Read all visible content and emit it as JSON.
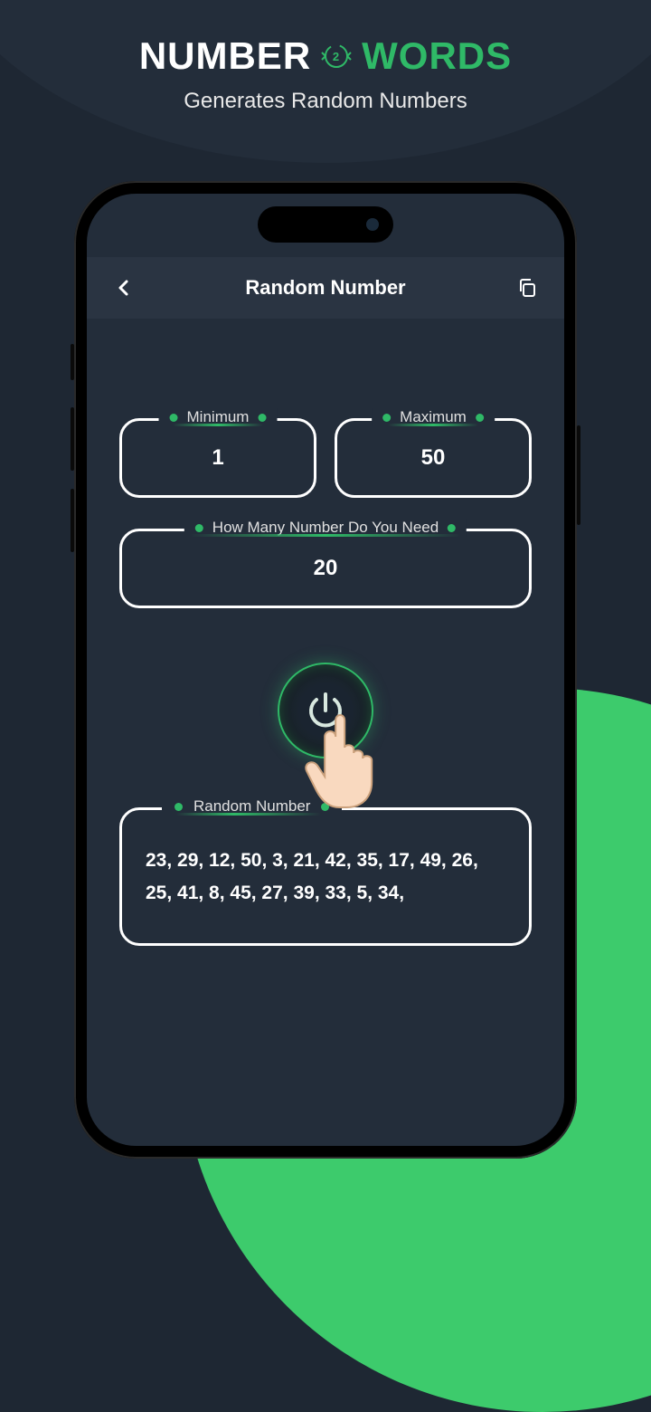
{
  "promo": {
    "title_part1": "NUMBER",
    "title_badge": "2",
    "title_part2": "WORDS",
    "subtitle": "Generates Random Numbers"
  },
  "appbar": {
    "title": "Random Number"
  },
  "fields": {
    "min_label": "Minimum",
    "min_value": "1",
    "max_label": "Maximum",
    "max_value": "50",
    "count_label": "How Many Number Do You Need",
    "count_value": "20"
  },
  "result": {
    "label": "Random Number",
    "text": "23, 29, 12, 50, 3, 21, 42, 35, 17, 49, 26, 25, 41, 8, 45, 27, 39, 33, 5, 34,"
  }
}
